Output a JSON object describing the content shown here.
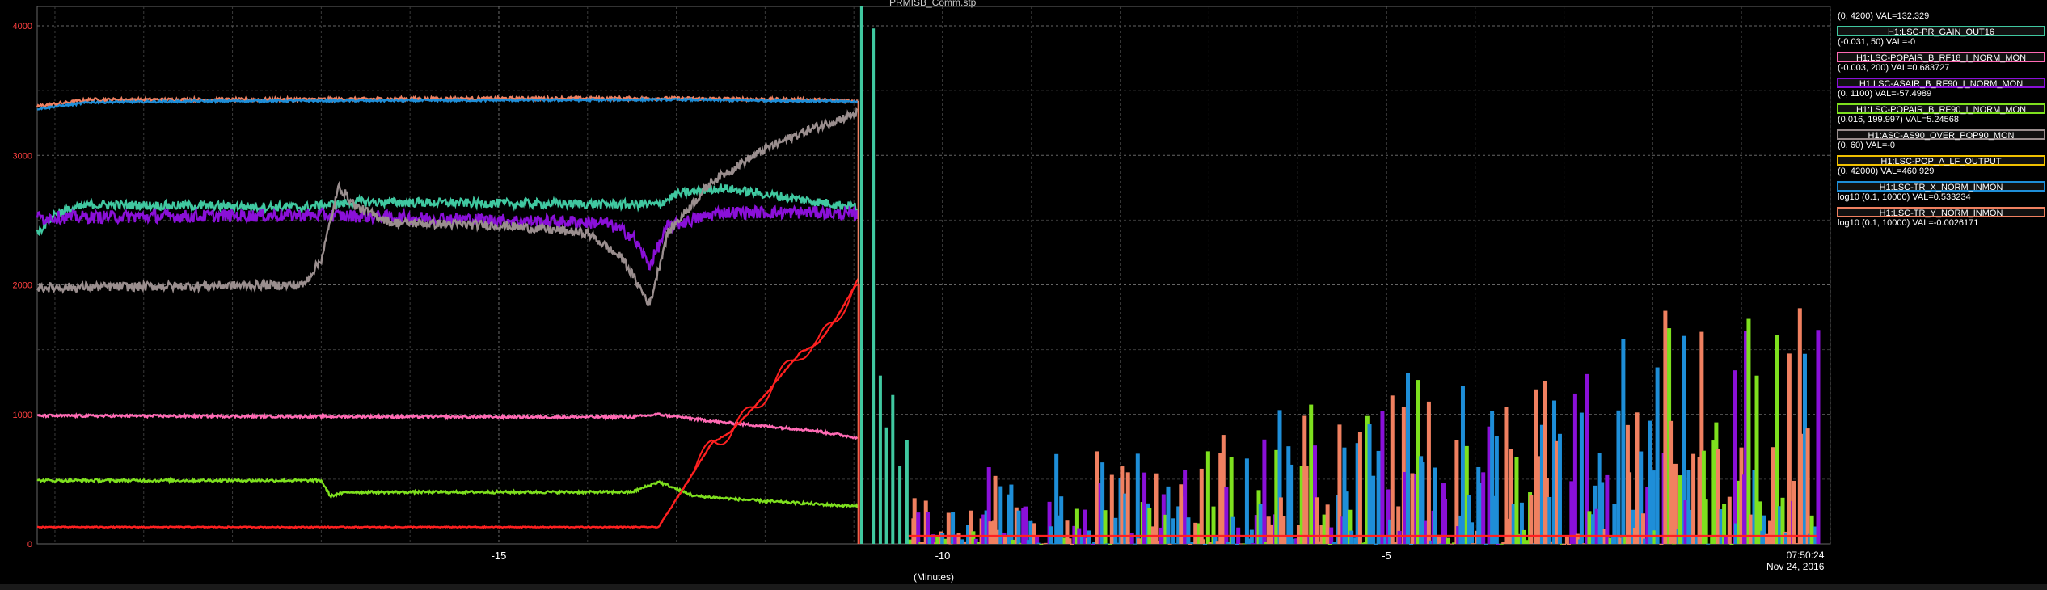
{
  "window": {
    "title": "PRMISB_Comm.stp"
  },
  "legend": [
    {
      "name": "",
      "value": "(0, 4200) VAL=132.329",
      "color": "#ff5ad0"
    },
    {
      "name": "H1:LSC-PR_GAIN_OUT16",
      "value": "(-0.031, 50) VAL=-0",
      "color": "#40c8a0"
    },
    {
      "name": "H1:LSC-POPAIR_B_RF18_I_NORM_MON",
      "value": "(-0.003, 200) VAL=0.683727",
      "color": "#ff6ab4"
    },
    {
      "name": "H1:LSC-ASAIR_B_RF90_I_NORM_MON",
      "value": "(0, 1100) VAL=-57.4989",
      "color": "#8a10d8"
    },
    {
      "name": "H1:LSC-POPAIR_B_RF90_I_NORM_MON",
      "value": "(0.016, 199.997) VAL=5.24568",
      "color": "#7ee01e"
    },
    {
      "name": "H1:ASC-AS90_OVER_POP90_MON",
      "value": "(0, 60) VAL=-0",
      "color": "#9a8e8e"
    },
    {
      "name": "H1:LSC-POP_A_LF_OUTPUT",
      "value": "(0, 42000) VAL=460.929",
      "color": "#f0c000"
    },
    {
      "name": "H1:LSC-TR_X_NORM_INMON",
      "value": "log10 (0.1, 10000) VAL=0.533234",
      "color": "#1e8ed8"
    },
    {
      "name": "H1:LSC-TR_Y_NORM_INMON",
      "value": "log10 (0.1, 10000) VAL=-0.0026171",
      "color": "#f08060"
    }
  ],
  "axes": {
    "xlabel": "(Minutes)",
    "timestamp_time": "07:50:24",
    "timestamp_date": "Nov 24, 2016"
  },
  "chart_data": {
    "type": "line",
    "x_range": [
      -20.2,
      0
    ],
    "y_range": [
      0,
      4150
    ],
    "x_ticks": [
      {
        "value": -15,
        "label": "-15"
      },
      {
        "value": -10,
        "label": "-10"
      },
      {
        "value": -5,
        "label": "-5"
      }
    ],
    "y_ticks": [
      {
        "value": 0,
        "label": "0"
      },
      {
        "value": 1000,
        "label": "1000"
      },
      {
        "value": 2000,
        "label": "2000"
      },
      {
        "value": 3000,
        "label": "3000"
      },
      {
        "value": 4000,
        "label": "4000"
      }
    ],
    "grid": true,
    "lock_loss_x": -10.95,
    "series": [
      {
        "name": "H1:LSC-TR_Y_NORM_INMON",
        "color": "#f08060",
        "noise": 12,
        "points": [
          [
            -20.2,
            3380
          ],
          [
            -19.6,
            3430
          ],
          [
            -18,
            3430
          ],
          [
            -15,
            3440
          ],
          [
            -13,
            3440
          ],
          [
            -11.5,
            3430
          ],
          [
            -10.95,
            3420
          ]
        ]
      },
      {
        "name": "H1:LSC-TR_X_NORM_INMON",
        "color": "#1e8ed8",
        "noise": 8,
        "points": [
          [
            -20.2,
            3360
          ],
          [
            -19.6,
            3410
          ],
          [
            -18,
            3420
          ],
          [
            -15,
            3425
          ],
          [
            -13,
            3430
          ],
          [
            -11.5,
            3420
          ],
          [
            -10.95,
            3415
          ]
        ]
      },
      {
        "name": "H1:LSC-PR_GAIN_OUT16",
        "color": "#40c8a0",
        "noise": 35,
        "points": [
          [
            -20.2,
            2400
          ],
          [
            -20.0,
            2550
          ],
          [
            -19.6,
            2620
          ],
          [
            -17.2,
            2600
          ],
          [
            -16.6,
            2640
          ],
          [
            -15,
            2630
          ],
          [
            -13.2,
            2620
          ],
          [
            -13.0,
            2700
          ],
          [
            -12.5,
            2750
          ],
          [
            -11.5,
            2650
          ],
          [
            -10.95,
            2600
          ]
        ]
      },
      {
        "name": "H1:LSC-ASAIR_B_RF90_I_NORM_MON",
        "color": "#8a10d8",
        "noise": 50,
        "points": [
          [
            -20.2,
            2520
          ],
          [
            -17,
            2540
          ],
          [
            -15,
            2500
          ],
          [
            -13.8,
            2480
          ],
          [
            -13.5,
            2380
          ],
          [
            -13.3,
            2150
          ],
          [
            -13.1,
            2450
          ],
          [
            -12.5,
            2560
          ],
          [
            -11.5,
            2560
          ],
          [
            -10.95,
            2540
          ]
        ]
      },
      {
        "name": "H1:ASC-AS90_OVER_POP90_MON",
        "color": "#9a8e8e",
        "noise": 35,
        "points": [
          [
            -20.2,
            1980
          ],
          [
            -17.2,
            2000
          ],
          [
            -17.0,
            2200
          ],
          [
            -16.8,
            2760
          ],
          [
            -16.6,
            2600
          ],
          [
            -16.2,
            2480
          ],
          [
            -15,
            2460
          ],
          [
            -14,
            2400
          ],
          [
            -13.6,
            2200
          ],
          [
            -13.3,
            1850
          ],
          [
            -13.1,
            2400
          ],
          [
            -12.6,
            2800
          ],
          [
            -12.0,
            3050
          ],
          [
            -11.5,
            3200
          ],
          [
            -10.95,
            3330
          ]
        ]
      },
      {
        "name": "H1:LSC-POPAIR_B_RF18_I_NORM_MON",
        "color": "#ff6ab4",
        "noise": 10,
        "points": [
          [
            -20.2,
            990
          ],
          [
            -15,
            980
          ],
          [
            -13.5,
            980
          ],
          [
            -13.2,
            1000
          ],
          [
            -12.5,
            940
          ],
          [
            -11.5,
            880
          ],
          [
            -10.95,
            820
          ]
        ]
      },
      {
        "name": "H1:LSC-POPAIR_B_RF90_I_NORM_MON",
        "color": "#7ee01e",
        "noise": 10,
        "points": [
          [
            -20.2,
            490
          ],
          [
            -17.0,
            490
          ],
          [
            -16.9,
            370
          ],
          [
            -16.7,
            400
          ],
          [
            -15,
            400
          ],
          [
            -13.5,
            400
          ],
          [
            -13.2,
            480
          ],
          [
            -12.8,
            370
          ],
          [
            -12,
            330
          ],
          [
            -10.95,
            290
          ]
        ]
      },
      {
        "name": "H1:LSC-POP_A_LF_OUTPUT",
        "color": "#ff2020",
        "noise": 4,
        "points": [
          [
            -20.2,
            130
          ],
          [
            -13.2,
            130
          ],
          [
            -12.8,
            560
          ],
          [
            -12.6,
            780
          ],
          [
            -12.4,
            860
          ],
          [
            -12.2,
            1000
          ],
          [
            -12.0,
            1150
          ],
          [
            -11.8,
            1320
          ],
          [
            -11.6,
            1480
          ],
          [
            -11.4,
            1550
          ],
          [
            -11.2,
            1740
          ],
          [
            -11.0,
            1980
          ],
          [
            -10.95,
            2010
          ]
        ]
      }
    ],
    "spikes": {
      "x_start": -10.4,
      "x_end": -0.15,
      "max": 1820,
      "colors": [
        "#f08060",
        "#1e8ed8",
        "#8a10d8",
        "#7ee01e",
        "#f08060",
        "#1e8ed8"
      ]
    }
  }
}
